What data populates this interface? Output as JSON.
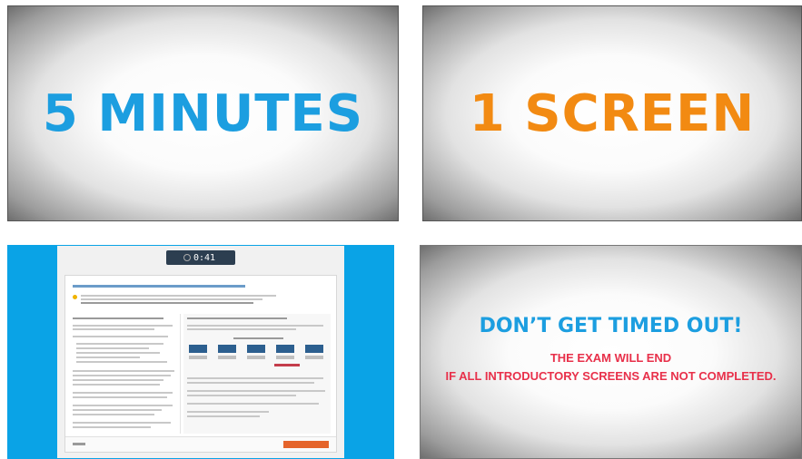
{
  "panels": {
    "minutes": {
      "text": "5 MINUTES",
      "color": "#1c9ee0"
    },
    "screen": {
      "text": "1 SCREEN",
      "color": "#f28a12"
    },
    "exam": {
      "timer": {
        "time": "0:41",
        "unit": ""
      },
      "background_color": "#0aa3e6",
      "next_button_color": "#e5642b"
    },
    "warning": {
      "headline": "DON’T GET TIMED OUT!",
      "line1": "THE EXAM WILL END",
      "line2": "IF ALL INTRODUCTORY SCREENS ARE NOT COMPLETED.",
      "headline_color": "#1c9ee0",
      "sub_color": "#e8304a"
    }
  }
}
